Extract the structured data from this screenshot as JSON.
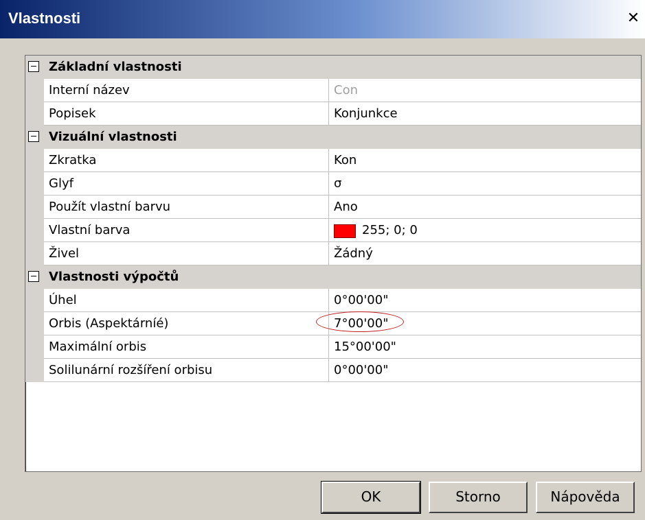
{
  "window": {
    "title": "Vlastnosti",
    "close_glyph": "✕"
  },
  "sections": [
    {
      "label": "Základní vlastnosti",
      "rows": [
        {
          "name": "Interní název",
          "value": "Con",
          "dim": true
        },
        {
          "name": "Popisek",
          "value": "Konjunkce"
        }
      ]
    },
    {
      "label": "Vizuální vlastnosti",
      "rows": [
        {
          "name": "Zkratka",
          "value": "Kon"
        },
        {
          "name": "Glyf",
          "value": "σ"
        },
        {
          "name": "Použít vlastní barvu",
          "value": "Ano"
        },
        {
          "name": "Vlastní barva",
          "value": "255; 0; 0",
          "swatch": "#ff0000"
        },
        {
          "name": "Živel",
          "value": "Žádný"
        }
      ]
    },
    {
      "label": "Vlastnosti výpočtů",
      "rows": [
        {
          "name": "Úhel",
          "value": "0°00'00\""
        },
        {
          "name": "Orbis (Aspektárníé)",
          "value": "7°00'00\""
        },
        {
          "name": "Maximální orbis",
          "value": "15°00'00\""
        },
        {
          "name": "Solilunární rozšíření orbisu",
          "value": "0°00'00\""
        }
      ]
    }
  ],
  "buttons": {
    "ok": "OK",
    "cancel": "Storno",
    "help": "Nápověda"
  }
}
